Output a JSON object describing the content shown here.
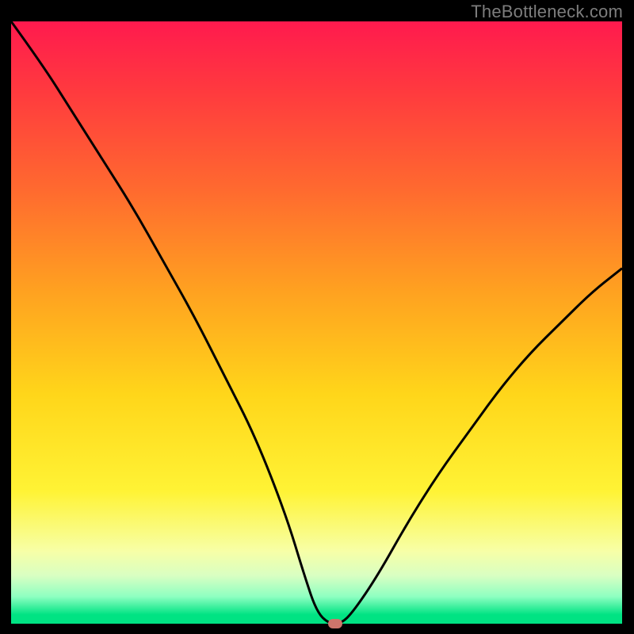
{
  "watermark": {
    "text": "TheBottleneck.com"
  },
  "colors": {
    "gradient_stops": [
      {
        "offset": 0.0,
        "color": "#ff1a4e"
      },
      {
        "offset": 0.12,
        "color": "#ff3b3e"
      },
      {
        "offset": 0.28,
        "color": "#ff6a2f"
      },
      {
        "offset": 0.45,
        "color": "#ffa220"
      },
      {
        "offset": 0.62,
        "color": "#ffd61a"
      },
      {
        "offset": 0.78,
        "color": "#fff335"
      },
      {
        "offset": 0.88,
        "color": "#f7ffa7"
      },
      {
        "offset": 0.92,
        "color": "#d9ffc2"
      },
      {
        "offset": 0.955,
        "color": "#8effc1"
      },
      {
        "offset": 0.985,
        "color": "#00e383"
      },
      {
        "offset": 1.0,
        "color": "#00e383"
      }
    ],
    "curve": "#000000",
    "marker": "#cf756b"
  },
  "chart_data": {
    "type": "line",
    "title": "",
    "xlabel": "",
    "ylabel": "",
    "xlim": [
      0,
      100
    ],
    "ylim": [
      0,
      100
    ],
    "series": [
      {
        "name": "bottleneck-curve",
        "x": [
          0,
          5,
          10,
          15,
          20,
          25,
          30,
          35,
          40,
          45,
          48,
          50,
          52,
          54,
          56,
          60,
          65,
          70,
          75,
          80,
          85,
          90,
          95,
          100
        ],
        "y": [
          100,
          93,
          85,
          77,
          69,
          60,
          51,
          41,
          31,
          18,
          8,
          2,
          0,
          0,
          2,
          8,
          17,
          25,
          32,
          39,
          45,
          50,
          55,
          59
        ]
      }
    ],
    "marker": {
      "x": 53,
      "y": 0
    },
    "annotations": []
  }
}
